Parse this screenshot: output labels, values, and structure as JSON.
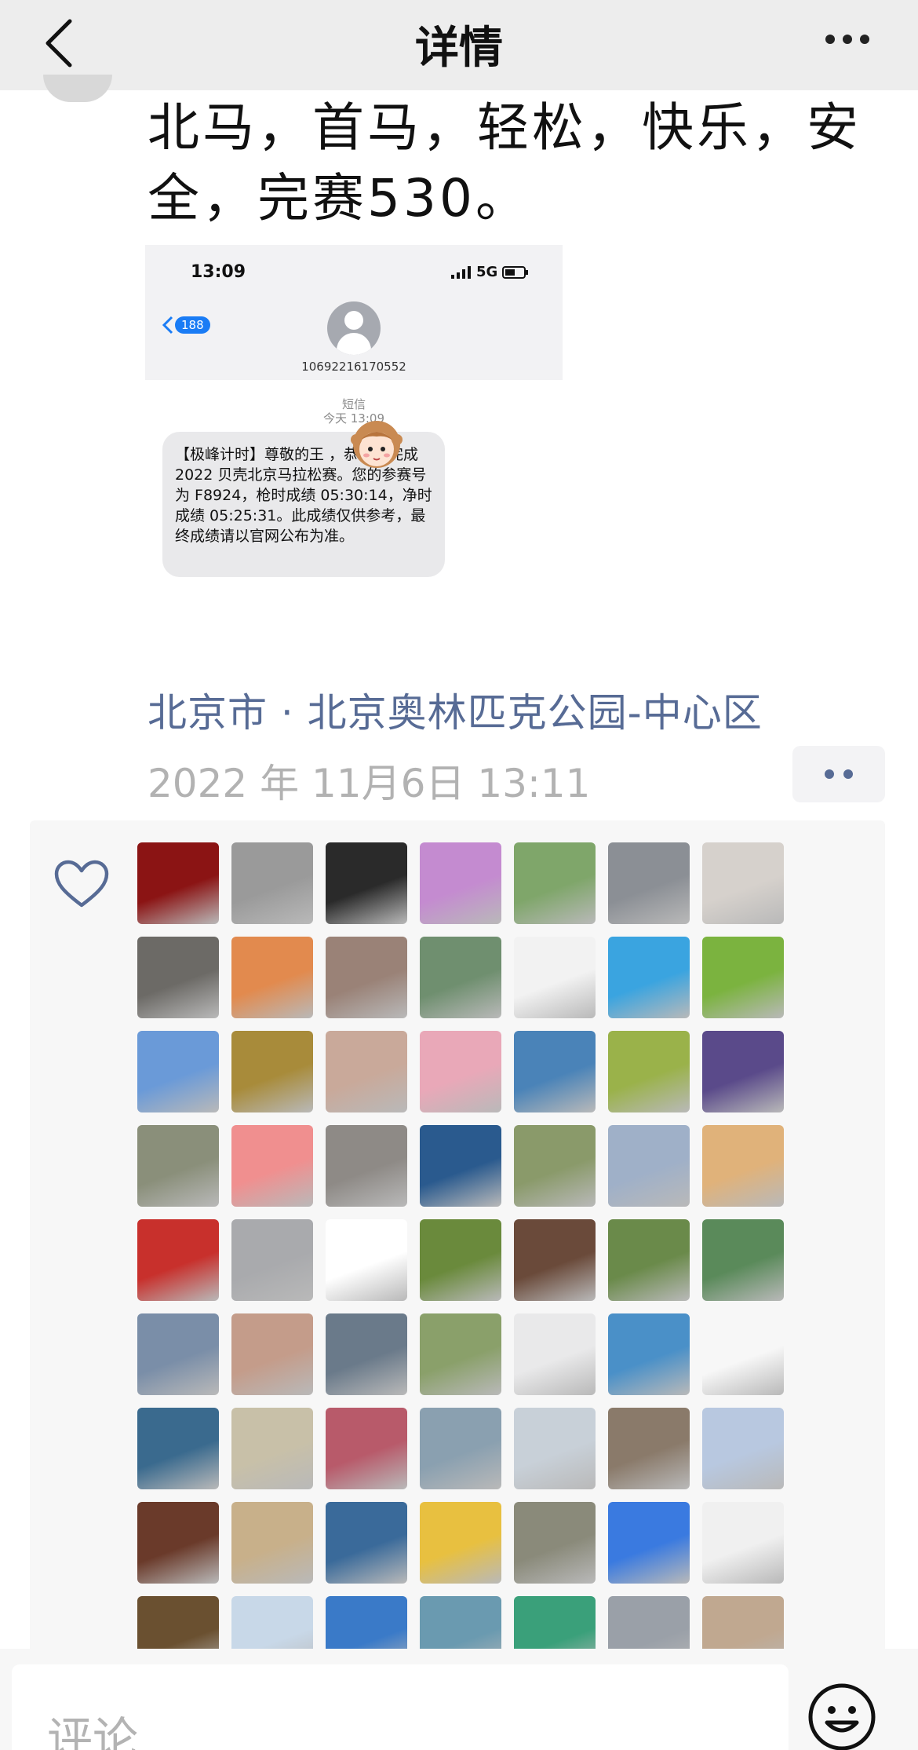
{
  "header": {
    "title": "详情"
  },
  "post": {
    "text": "北马，首马，轻松，快乐，安全，完赛530。",
    "location": "北京市 · 北京奥林匹克公园-中心区",
    "time": "2022 年 11月6日 13:11"
  },
  "sms": {
    "status_time": "13:09",
    "status_network": "5G",
    "back_badge": "188",
    "sender_number": "10692216170552",
    "meta_line1": "短信",
    "meta_line2": "今天 13:09",
    "message": "【极峰计时】尊敬的王          ，恭喜您完成 2022 贝壳北京马拉松赛。您的参赛号为 F8924，枪时成绩 05:30:14，净时成绩 05:25:31。此成绩仅供参考，最终成绩请以官网公布为准。"
  },
  "likes": {
    "count_rows": 9,
    "columns": 7,
    "avatar_colors": [
      "#8b1414",
      "#9a9a9a",
      "#2a2a2a",
      "#c48bd0",
      "#7fa66a",
      "#8b8f95",
      "#d6d1cc",
      "#6c6a66",
      "#e28a4e",
      "#9a8277",
      "#6f8f6f",
      "#f2f2f2",
      "#3aa4e0",
      "#7bb33f",
      "#6a9ad8",
      "#a88b3a",
      "#c9a99a",
      "#e9a8b8",
      "#4a83b8",
      "#9ab24a",
      "#5a4a8a",
      "#8a8f7a",
      "#f08f8f",
      "#8e8a86",
      "#2a5a8e",
      "#8a9a6a",
      "#9fb0c8",
      "#e0b27a",
      "#c8302c",
      "#a9aaad",
      "#ffffff",
      "#6a8a3c",
      "#6a4a3a",
      "#6a8a4a",
      "#5a8a5a",
      "#7a8ea8",
      "#c49c8a",
      "#6a7a8a",
      "#8aa06a",
      "#e9e9ea",
      "#4a90c8",
      "#f7f7f7",
      "#3a6a8e",
      "#c8c0a8",
      "#b85a6a",
      "#8aa0b0",
      "#c8d0d8",
      "#8a7a6a",
      "#b8c8e0",
      "#6a3a2a",
      "#c8b08a",
      "#3a6a9a",
      "#e8c040",
      "#8a8a7a",
      "#3a7ae0",
      "#f0f0f0",
      "#6a5030",
      "#c8d8e8",
      "#3a7ac8",
      "#6a9ab0",
      "#3aa07a",
      "#9aa0a8",
      "#c0a890"
    ]
  },
  "comment": {
    "placeholder": "评论"
  },
  "icons": {
    "back": "chevron-left-icon",
    "more": "more-icon",
    "like": "heart-icon",
    "emoji": "smile-icon",
    "options": "options-icon"
  }
}
